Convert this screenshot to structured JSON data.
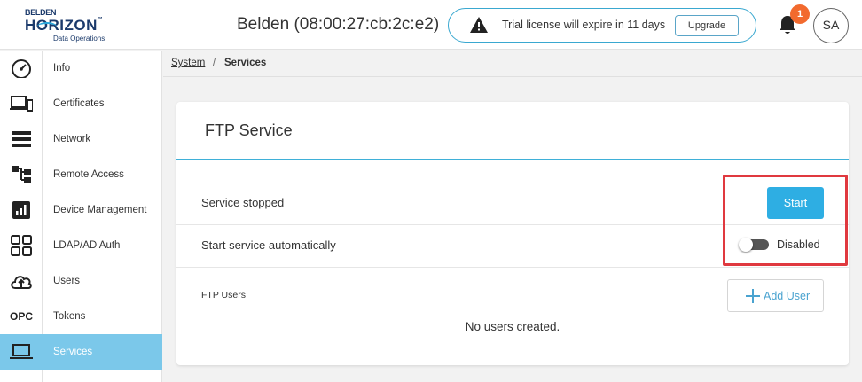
{
  "brand": {
    "line1": "BELDEN",
    "line2": "HORIZON",
    "trademark": "™",
    "line3": "Data Operations",
    "primary_color": "#1b3a6b",
    "accent_color": "#2aa7dc"
  },
  "header": {
    "device_title": "Belden (08:00:27:cb:2c:e2)",
    "license": {
      "icon": "warning-icon",
      "text": "Trial license will expire in 11 days",
      "upgrade_label": "Upgrade"
    },
    "notifications": {
      "icon": "bell-icon",
      "count": "1",
      "badge_color": "#f26a2e"
    },
    "user_initials": "SA"
  },
  "icon_rail": [
    {
      "icon": "dashboard-icon",
      "active": false
    },
    {
      "icon": "devices-icon",
      "active": false
    },
    {
      "icon": "list-icon",
      "active": false
    },
    {
      "icon": "topology-icon",
      "active": false
    },
    {
      "icon": "reports-icon",
      "active": false
    },
    {
      "icon": "apps-grid-icon",
      "active": false
    },
    {
      "icon": "cloud-upload-icon",
      "active": false
    },
    {
      "icon": "opc-icon",
      "text": "OPC",
      "active": false
    },
    {
      "icon": "laptop-icon",
      "active": true
    }
  ],
  "submenu": {
    "items": [
      {
        "label": "Info"
      },
      {
        "label": "Certificates"
      },
      {
        "label": "Network"
      },
      {
        "label": "Remote Access"
      },
      {
        "label": "Device Management"
      },
      {
        "label": "LDAP/AD Auth"
      },
      {
        "label": "Users"
      },
      {
        "label": "Tokens"
      },
      {
        "label": "Services"
      }
    ],
    "active_label": "Services",
    "active_color": "#7bc8ea"
  },
  "breadcrumb": {
    "parent": "System",
    "separator": "/",
    "current": "Services"
  },
  "ftp_service": {
    "title": "FTP Service",
    "status_text": "Service stopped",
    "start_label": "Start",
    "auto_start_label": "Start service automatically",
    "auto_start_state": "Disabled",
    "auto_start_enabled": false,
    "ftp_users_label": "FTP Users",
    "add_user_label": "Add User",
    "empty_message": "No users created.",
    "accent_color": "#2eaee3"
  },
  "annotation": {
    "highlight_color": "#e0393f"
  }
}
